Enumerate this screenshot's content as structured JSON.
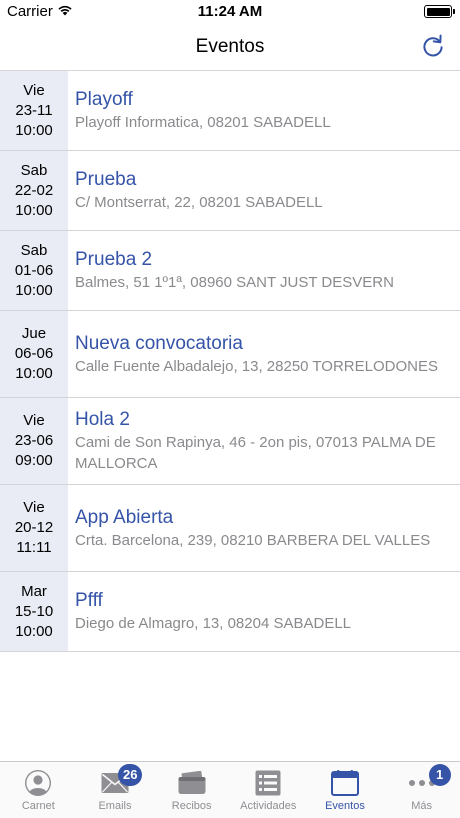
{
  "status_bar": {
    "carrier": "Carrier",
    "time": "11:24 AM"
  },
  "nav": {
    "title": "Eventos"
  },
  "events": [
    {
      "day": "Vie",
      "date": "23-11",
      "time": "10:00",
      "title": "Playoff",
      "address": "Playoff Informatica, 08201 SABADELL"
    },
    {
      "day": "Sab",
      "date": "22-02",
      "time": "10:00",
      "title": "Prueba",
      "address": "C/ Montserrat, 22, 08201 SABADELL"
    },
    {
      "day": "Sab",
      "date": "01-06",
      "time": "10:00",
      "title": "Prueba 2",
      "address": "Balmes, 51 1º1ª, 08960 SANT JUST DESVERN"
    },
    {
      "day": "Jue",
      "date": "06-06",
      "time": "10:00",
      "title": "Nueva convocatoria",
      "address": "Calle Fuente Albadalejo, 13, 28250 TORRELODONES"
    },
    {
      "day": "Vie",
      "date": "23-06",
      "time": "09:00",
      "title": "Hola 2",
      "address": "Cami de Son Rapinya, 46 - 2on pis, 07013 PALMA DE MALLORCA"
    },
    {
      "day": "Vie",
      "date": "20-12",
      "time": "11:11",
      "title": "App Abierta",
      "address": "Crta. Barcelona, 239, 08210 BARBERA DEL VALLES"
    },
    {
      "day": "Mar",
      "date": "15-10",
      "time": "10:00",
      "title": "Pfff",
      "address": "Diego de Almagro, 13, 08204 SABADELL"
    }
  ],
  "tabs": [
    {
      "label": "Carnet",
      "icon": "person-icon"
    },
    {
      "label": "Emails",
      "icon": "envelope-icon",
      "badge": "26"
    },
    {
      "label": "Recibos",
      "icon": "wallet-icon"
    },
    {
      "label": "Actividades",
      "icon": "list-icon"
    },
    {
      "label": "Eventos",
      "icon": "calendar-icon",
      "active": true
    },
    {
      "label": "Más",
      "icon": "more-icon",
      "badge": "1"
    }
  ],
  "colors": {
    "accent": "#3554a8",
    "date_bg": "#e9ecf5",
    "secondary_text": "#8a8a8e",
    "tab_inactive": "#8e8e93"
  }
}
